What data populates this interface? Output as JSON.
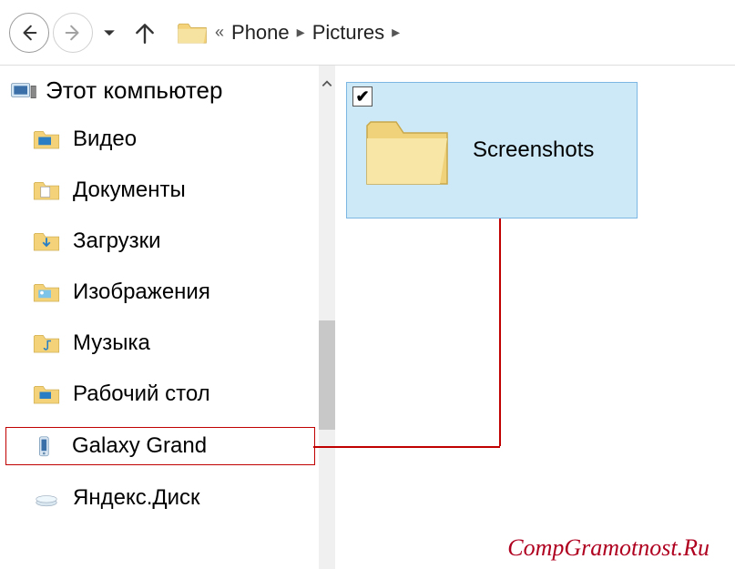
{
  "toolbar": {
    "back_enabled": true,
    "forward_enabled": false
  },
  "breadcrumb": {
    "items": [
      "Phone",
      "Pictures"
    ]
  },
  "sidebar": {
    "root_label": "Этот компьютер",
    "items": [
      {
        "label": "Видео"
      },
      {
        "label": "Документы"
      },
      {
        "label": "Загрузки"
      },
      {
        "label": "Изображения"
      },
      {
        "label": "Музыка"
      },
      {
        "label": "Рабочий стол"
      },
      {
        "label": "Galaxy Grand",
        "highlight": true
      },
      {
        "label": "Яндекс.Диск"
      }
    ]
  },
  "content": {
    "selected_folder": {
      "label": "Screenshots",
      "checked": true
    }
  },
  "watermark": "CompGramotnost.Ru",
  "colors": {
    "selection_bg": "#cde8f6",
    "selection_border": "#7cb6e2",
    "annotation": "#c00000"
  }
}
